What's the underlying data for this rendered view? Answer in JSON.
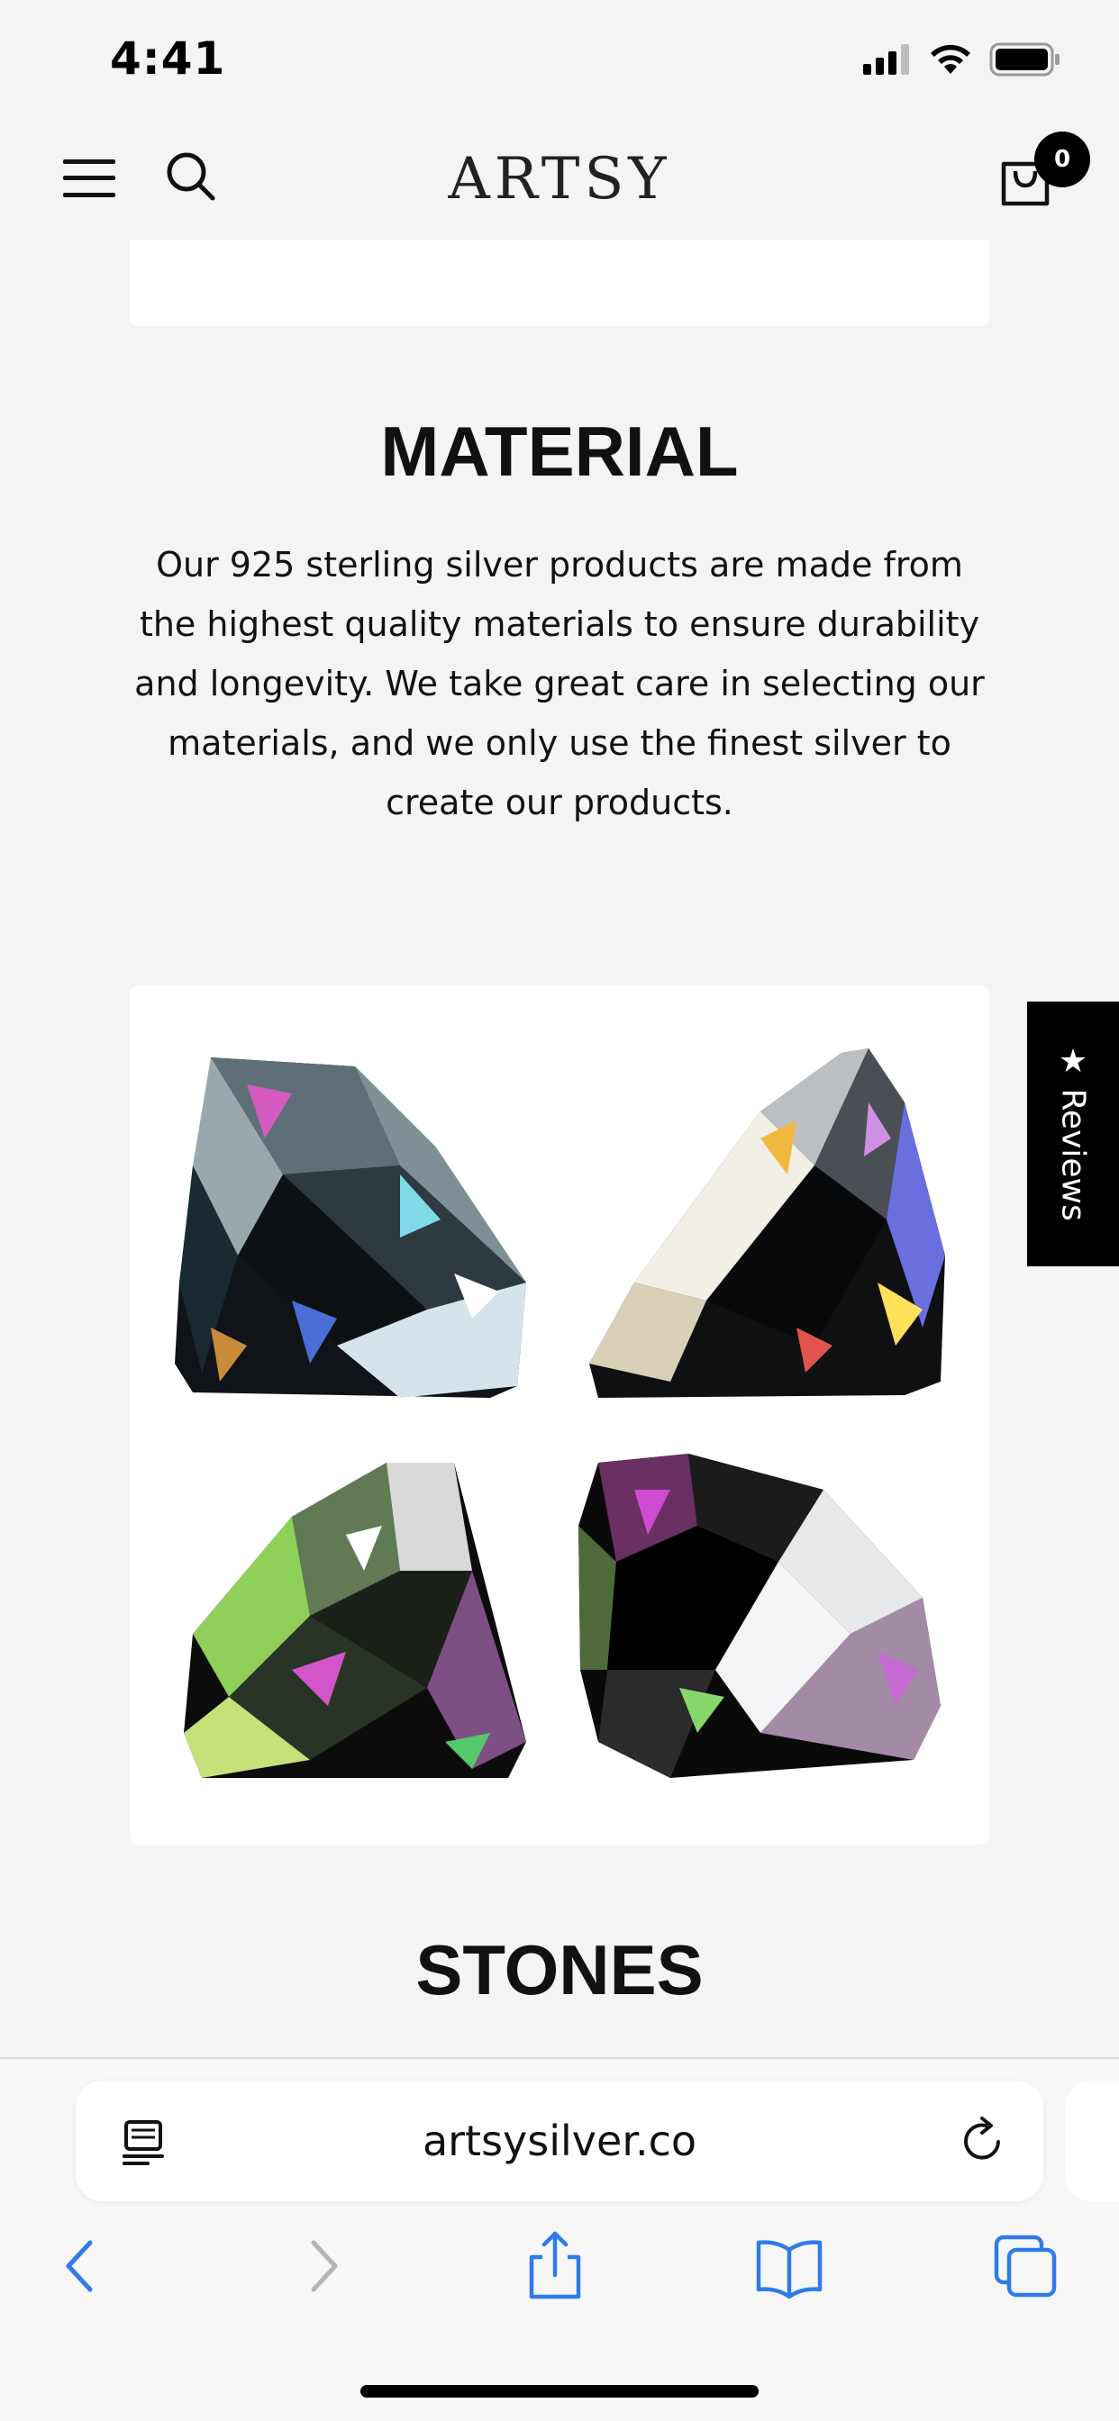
{
  "status": {
    "time": "4:41"
  },
  "header": {
    "logo": "ARTSY",
    "cart_count": "0"
  },
  "material": {
    "title": "MATERIAL",
    "text": "Our 925 sterling silver products are made from the highest quality materials to ensure durability and longevity. We take great care in selecting our materials, and we only use the finest silver to create our products."
  },
  "stones": {
    "title": "STONES"
  },
  "reviews_tab": {
    "label": "Reviews",
    "icon": "star-icon"
  },
  "browser": {
    "url": "artsysilver.co"
  },
  "colors": {
    "accent": "#2f7bea",
    "disabled": "#b5b5b5",
    "tab_bg": "#000000"
  }
}
